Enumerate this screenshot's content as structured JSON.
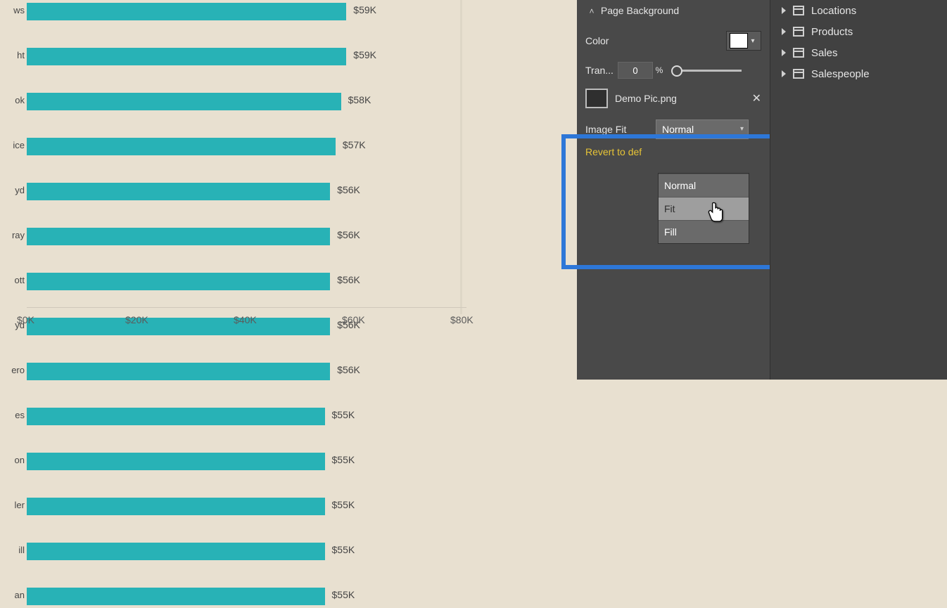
{
  "chart_data": {
    "type": "bar",
    "orientation": "horizontal",
    "categories": [
      "ws",
      "ht",
      "ok",
      "ice",
      "yd",
      "ray",
      "ott",
      "yd",
      "ero",
      "es",
      "on",
      "ler",
      "ill",
      "an"
    ],
    "values": [
      59,
      59,
      58,
      57,
      56,
      56,
      56,
      56,
      56,
      55,
      55,
      55,
      55,
      55
    ],
    "value_labels": [
      "$59K",
      "$59K",
      "$58K",
      "$57K",
      "$56K",
      "$56K",
      "$56K",
      "$56K",
      "$56K",
      "$55K",
      "$55K",
      "$55K",
      "$55K",
      "$55K"
    ],
    "xlim": [
      0,
      80
    ],
    "x_ticks": [
      "$0K",
      "$20K",
      "$40K",
      "$60K",
      "$80K"
    ],
    "bar_color": "#28b2b6",
    "background": "#e8e0d0"
  },
  "format": {
    "section": "Page Background",
    "color_label": "Color",
    "color_value": "#ffffff",
    "tran_label": "Tran...",
    "tran_value": "0",
    "tran_unit": "%",
    "image_name": "Demo Pic.png",
    "image_fit_label": "Image Fit",
    "image_fit_value": "Normal",
    "image_fit_options": [
      "Normal",
      "Fit",
      "Fill"
    ],
    "revert_label": "Revert to def"
  },
  "fields": {
    "items": [
      {
        "name": "Locations"
      },
      {
        "name": "Products"
      },
      {
        "name": "Sales"
      },
      {
        "name": "Salespeople"
      }
    ]
  }
}
